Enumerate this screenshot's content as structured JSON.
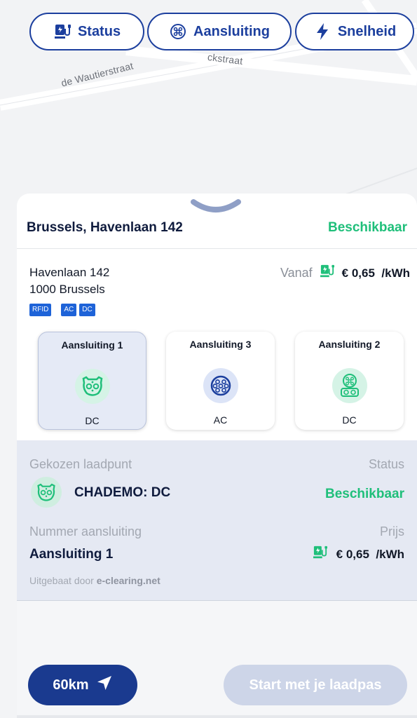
{
  "map": {
    "streets": [
      "de Wautierstraat",
      "ckstraat"
    ]
  },
  "filters": [
    {
      "label": "Status",
      "icon": "charger-icon"
    },
    {
      "label": "Aansluiting",
      "icon": "connector-icon"
    },
    {
      "label": "Snelheid",
      "icon": "lightning-icon"
    }
  ],
  "station": {
    "title": "Brussels, Havenlaan 142",
    "availability": "Beschikbaar",
    "address_line1": "Havenlaan 142",
    "address_line2": "1000 Brussels",
    "badges": [
      "RFID",
      "AC",
      "DC"
    ],
    "price_prefix": "Vanaf",
    "price": "€ 0,65",
    "price_unit": "/kWh"
  },
  "connectors": [
    {
      "title": "Aansluiting 1",
      "type": "DC",
      "icon": "chademo-icon",
      "selected": true
    },
    {
      "title": "Aansluiting 3",
      "type": "AC",
      "icon": "type2-icon",
      "selected": false
    },
    {
      "title": "Aansluiting 2",
      "type": "DC",
      "icon": "ccs-icon",
      "selected": false
    }
  ],
  "detail": {
    "chosen_label": "Gekozen laadpunt",
    "status_label": "Status",
    "connector_name": "CHADEMO: DC",
    "status_value": "Beschikbaar",
    "number_label": "Nummer aansluiting",
    "price_label": "Prijs",
    "number_value": "Aansluiting 1",
    "price": "€ 0,65",
    "price_unit": "/kWh",
    "operated_prefix": "Uitgebaat door",
    "operator": "e-clearing.net"
  },
  "actions": {
    "distance": "60km",
    "start": "Start met je laadpas"
  },
  "colors": {
    "primary": "#1c3f9e",
    "available": "#1fbf7a",
    "disabled_button": "#cdd5e8"
  }
}
